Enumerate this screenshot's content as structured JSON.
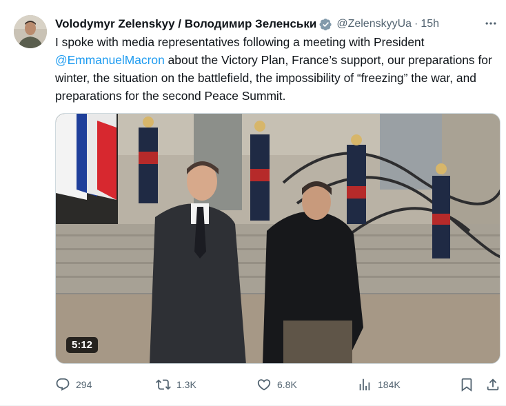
{
  "post": {
    "author_name": "Volodymyr Zelenskyy / Володимир Зеленськи",
    "handle": "@ZelenskyyUa",
    "separator": "·",
    "time": "15h",
    "text_part1": "I spoke with media representatives following a meeting with President ",
    "mention": "@EmmanuelMacron",
    "text_part2": " about the Victory Plan, France’s support, our preparations for winter, the situation on the battlefield, the impossibility of “freezing” the war, and preparations for the second Peace Summit.",
    "video_duration": "5:12"
  },
  "actions": {
    "replies": "294",
    "reposts": "1.3K",
    "likes": "6.8K",
    "views": "184K"
  },
  "colors": {
    "accent": "#1d9bf0",
    "muted": "#536471",
    "text": "#0f1419"
  },
  "icons": [
    "verified-badge-icon",
    "more-icon",
    "reply-icon",
    "repost-icon",
    "like-icon",
    "views-icon",
    "bookmark-icon",
    "share-icon"
  ]
}
